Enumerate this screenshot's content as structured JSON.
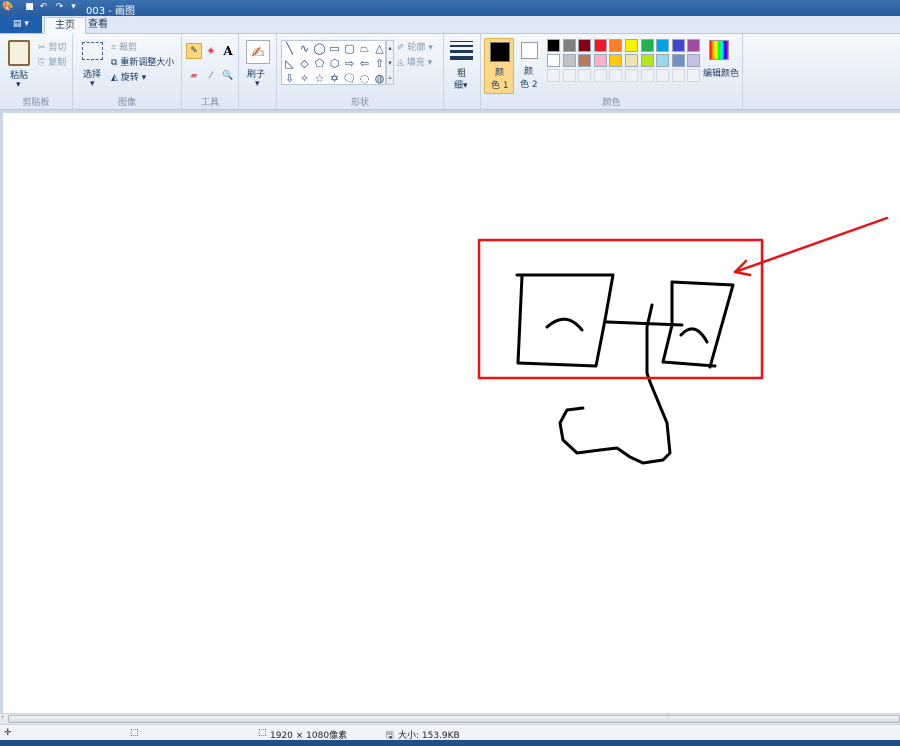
{
  "window": {
    "title": "003 - 画图"
  },
  "tabs": {
    "file": "▤ ▾",
    "home": "主页",
    "view": "查看"
  },
  "clipboard": {
    "paste": "粘贴",
    "cut": "剪切",
    "copy": "复制",
    "group": "剪贴板"
  },
  "image": {
    "select": "选择",
    "crop": "裁剪",
    "resize": "重新调整大小",
    "rotate": "旋转",
    "group": "图像"
  },
  "tools": {
    "group": "工具"
  },
  "brushes": {
    "label": "刷子"
  },
  "shapes": {
    "outline": "轮廓",
    "fill": "填充",
    "group": "形状",
    "items": [
      "╲",
      "∿",
      "◯",
      "▭",
      "▢",
      "⏢",
      "△",
      "◺",
      "◇",
      "⬠",
      "⬡",
      "⇨",
      "⇦",
      "⇧",
      "⇩",
      "✧",
      "☆",
      "✡",
      "🗨",
      "◌",
      "◍"
    ]
  },
  "size": {
    "label_line1": "粗",
    "label_line2": "细"
  },
  "colors": {
    "color1_line1": "颜",
    "color1_line2": "色 1",
    "color2_line1": "颜",
    "color2_line2": "色 2",
    "edit": "编辑颜色",
    "group": "颜色",
    "color1": "#000000",
    "color2": "#ffffff",
    "palette_row1": [
      "#000000",
      "#7f7f7f",
      "#880015",
      "#ed1c24",
      "#ff7f27",
      "#fff200",
      "#22b14c",
      "#00a2e8",
      "#3f48cc",
      "#a349a4"
    ],
    "palette_row2": [
      "#ffffff",
      "#c3c3c3",
      "#b97a57",
      "#ffaec9",
      "#ffc90e",
      "#efe4b0",
      "#b5e61d",
      "#99d9ea",
      "#7092be",
      "#c8bfe7"
    ]
  },
  "status": {
    "dimensions": "1920 × 1080像素",
    "size": "大小: 153.9KB"
  },
  "drawing": {
    "ink": "#000000",
    "annotation": "#ee1111"
  }
}
